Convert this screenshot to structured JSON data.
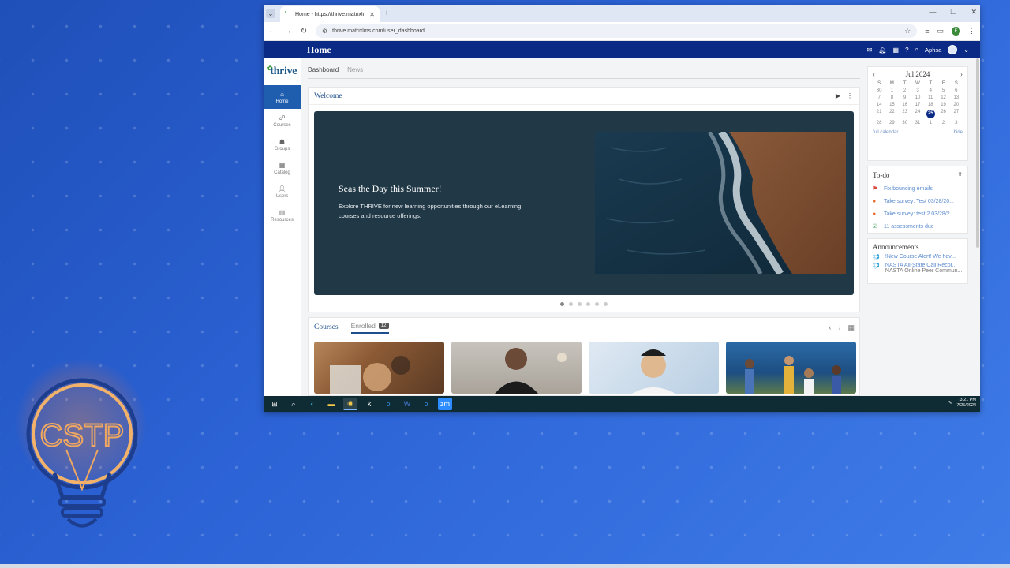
{
  "browser": {
    "tab_title": "Home - https://thrive.matrixlms.com",
    "url": "thrive.matrixlms.com/user_dashboard",
    "profile_initial": "E"
  },
  "app": {
    "header_title": "Home",
    "user_name": "Aphsa",
    "logo": "thrive"
  },
  "sidebar": {
    "items": [
      {
        "label": "Home",
        "icon": "home-icon",
        "active": true
      },
      {
        "label": "Courses",
        "icon": "courses-icon"
      },
      {
        "label": "Groups",
        "icon": "groups-icon"
      },
      {
        "label": "Catalog",
        "icon": "catalog-icon"
      },
      {
        "label": "Users",
        "icon": "users-icon"
      },
      {
        "label": "Resources",
        "icon": "resources-icon"
      }
    ]
  },
  "subtabs": [
    "Dashboard",
    "News"
  ],
  "welcome": {
    "title": "Welcome",
    "banner_title": "Seas the Day this Summer!",
    "banner_body": "Explore THRIVE for new learning opportunities through our eLearning courses and resource offerings."
  },
  "courses": {
    "title": "Courses",
    "enrolled_label": "Enrolled",
    "enrolled_count": "12"
  },
  "calendar": {
    "month": "Jul 2024",
    "day_headers": [
      "S",
      "M",
      "T",
      "W",
      "T",
      "F",
      "S"
    ],
    "weeks": [
      [
        "30",
        "1",
        "2",
        "3",
        "4",
        "5",
        "6"
      ],
      [
        "7",
        "8",
        "9",
        "10",
        "11",
        "12",
        "13"
      ],
      [
        "14",
        "15",
        "16",
        "17",
        "18",
        "19",
        "20"
      ],
      [
        "21",
        "22",
        "23",
        "24",
        "25",
        "26",
        "27"
      ],
      [
        "28",
        "29",
        "30",
        "31",
        "1",
        "2",
        "3"
      ]
    ],
    "today": "25",
    "full_calendar": "full calendar",
    "hide": "hide"
  },
  "todo": {
    "title": "To-do",
    "items": [
      {
        "text": "Fix bouncing emails",
        "icon": "flag-icon",
        "color": "#d9463b"
      },
      {
        "text": "Take survey: Test 03/28/20...",
        "icon": "survey-icon",
        "color": "#e8743b"
      },
      {
        "text": "Take survey: test 2 03/28/2...",
        "icon": "survey-icon",
        "color": "#e8743b"
      },
      {
        "text": "11 assessments due",
        "icon": "checkbox-icon",
        "color": "#2e9a4a"
      }
    ]
  },
  "announcements": {
    "title": "Announcements",
    "items": [
      {
        "text": "!New Course Alert! We hav..."
      },
      {
        "text": "NASTA All-State Call Recor...",
        "sub": "NASTA Online Peer Commun..."
      }
    ]
  },
  "taskbar": {
    "time": "3:21 PM",
    "date": "7/25/2024"
  },
  "overlay": {
    "logo_text": "CSTP"
  }
}
